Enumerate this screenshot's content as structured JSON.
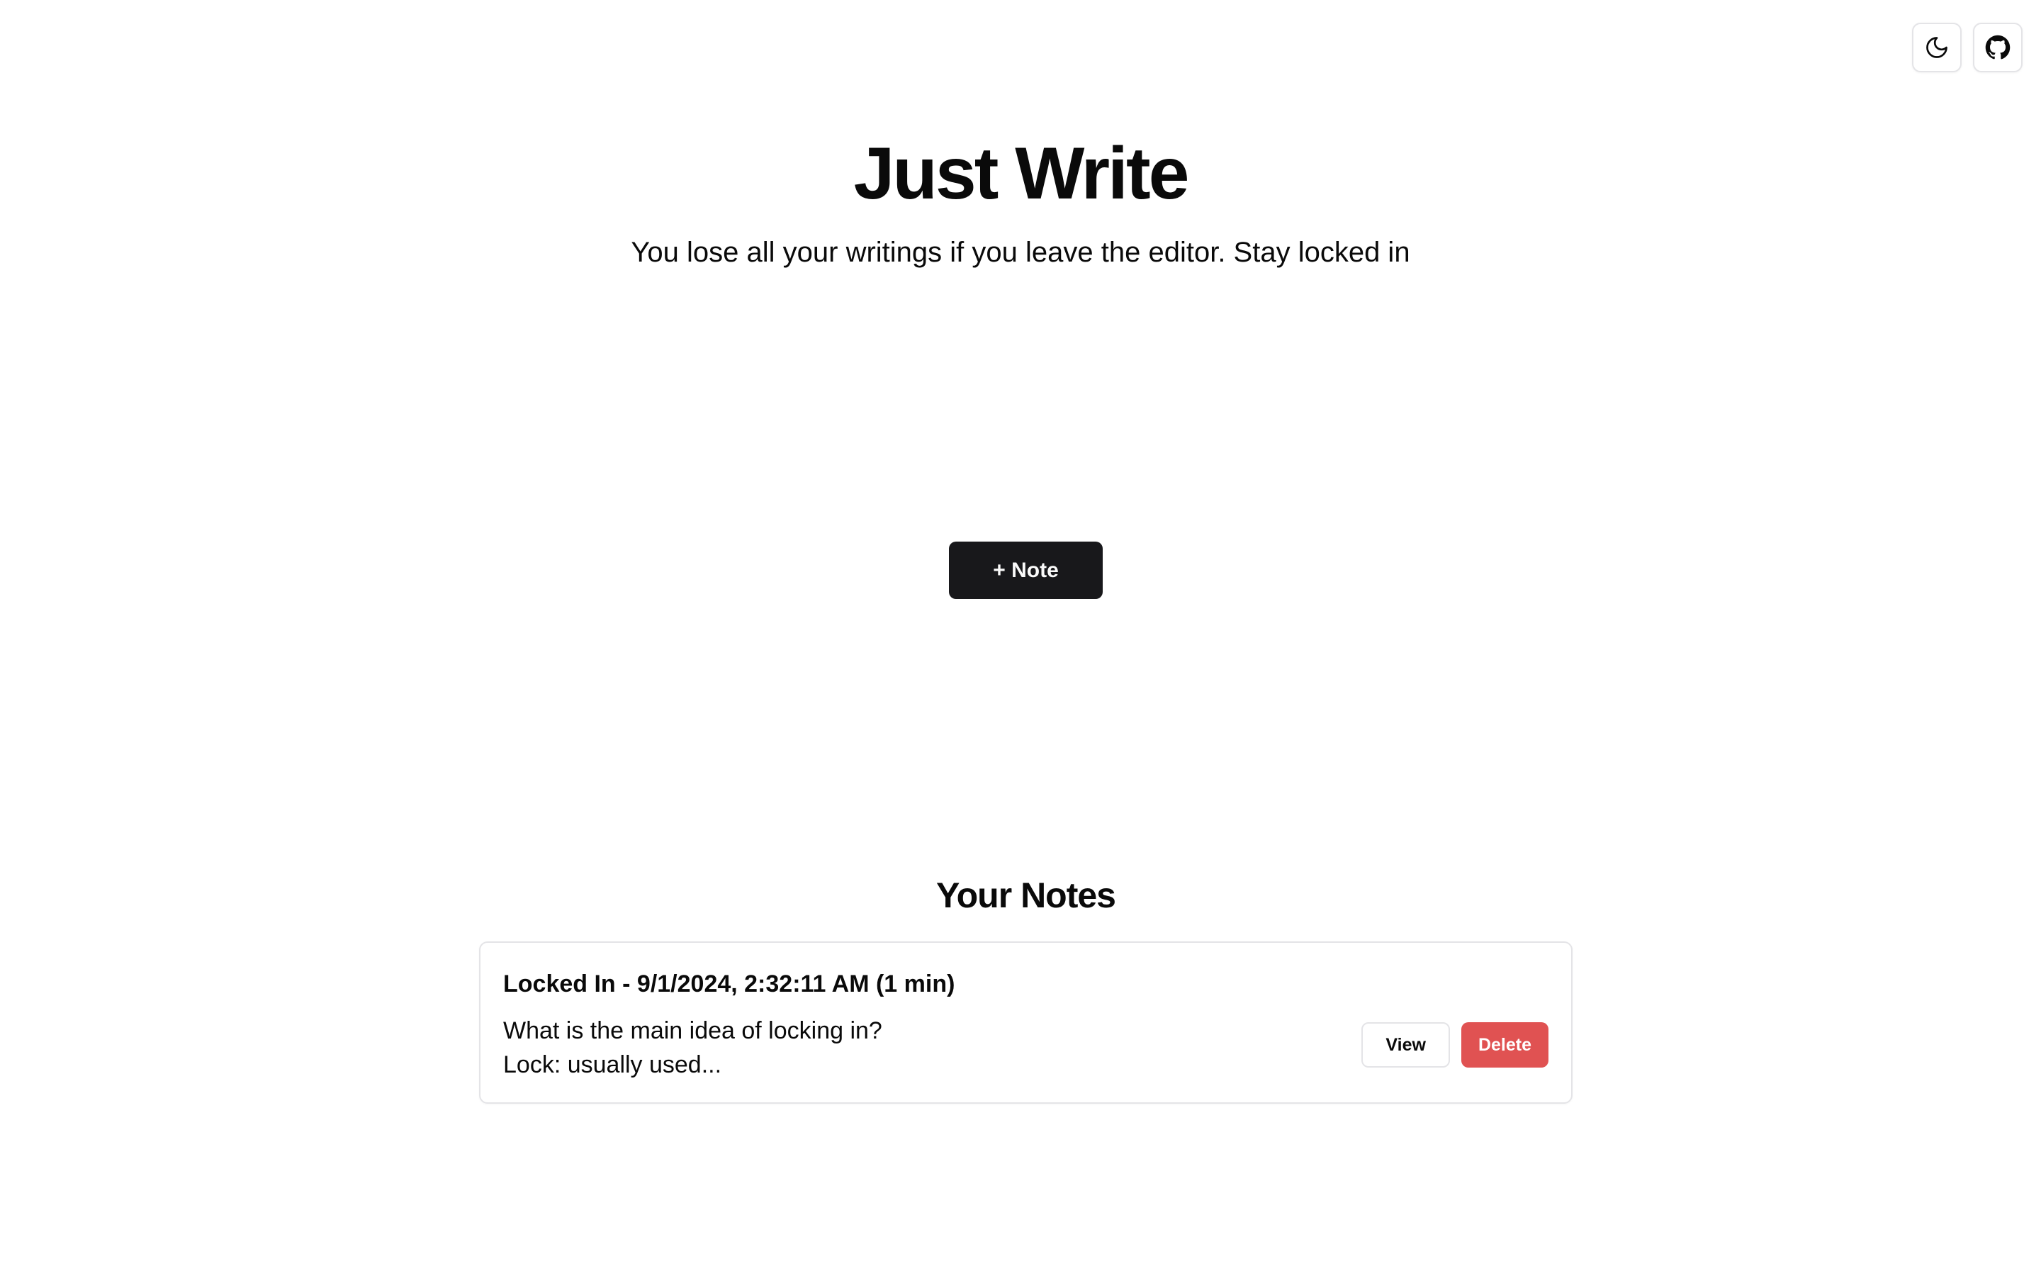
{
  "header": {
    "theme_toggle_icon": "moon-icon",
    "github_icon": "github-icon"
  },
  "hero": {
    "title": "Just Write",
    "subtitle": "You lose all your writings if you leave the editor. Stay locked in"
  },
  "actions": {
    "new_note_label": "+ Note"
  },
  "notes": {
    "heading": "Your Notes",
    "items": [
      {
        "title": "Locked In - 9/1/2024, 2:32:11 AM (1 min)",
        "preview_line1": "What is the main idea of locking in?",
        "preview_line2": "Lock: usually used...",
        "view_label": "View",
        "delete_label": "Delete"
      }
    ]
  },
  "colors": {
    "primary_button": "#18181b",
    "danger_button": "#e05252",
    "border": "#e4e4e7",
    "background": "#ffffff"
  }
}
